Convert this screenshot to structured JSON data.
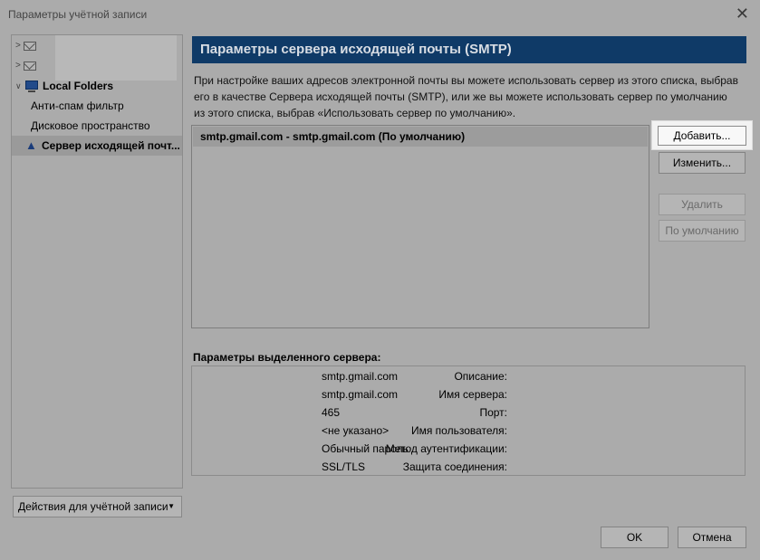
{
  "window": {
    "title": "Параметры учётной записи"
  },
  "tree": {
    "local_folders": "Local Folders",
    "items": [
      "Анти-спам фильтр",
      "Дисковое пространство",
      "Сервер исходящей почт..."
    ]
  },
  "account_actions": {
    "label": "Действия для учётной записи"
  },
  "smtp": {
    "header": "Параметры сервера исходящей почты (SMTP)",
    "description": "При настройке ваших адресов электронной почты вы можете использовать сервер из этого списка, выбрав его в качестве Сервера исходящей почты (SMTP), или же вы можете использовать сервер по умолчанию из этого списка, выбрав «Использовать сервер по умолчанию».",
    "servers": [
      "smtp.gmail.com - smtp.gmail.com (По умолчанию)"
    ],
    "buttons": {
      "add": "Добавить...",
      "edit": "Изменить...",
      "delete": "Удалить",
      "set_default": "По умолчанию"
    },
    "details_title": "Параметры выделенного сервера:",
    "details": [
      {
        "key": "Описание:",
        "value": "smtp.gmail.com"
      },
      {
        "key": "Имя сервера:",
        "value": "smtp.gmail.com"
      },
      {
        "key": "Порт:",
        "value": "465"
      },
      {
        "key": "Имя пользователя:",
        "value": "<не указано>"
      },
      {
        "key": "Метод аутентификации:",
        "value": "Обычный пароль"
      },
      {
        "key": "Защита соединения:",
        "value": "SSL/TLS"
      }
    ]
  },
  "dialog": {
    "ok": "OK",
    "cancel": "Отмена"
  },
  "colors": {
    "header_bg": "#0f3a67",
    "window_bg": "#ababab"
  }
}
